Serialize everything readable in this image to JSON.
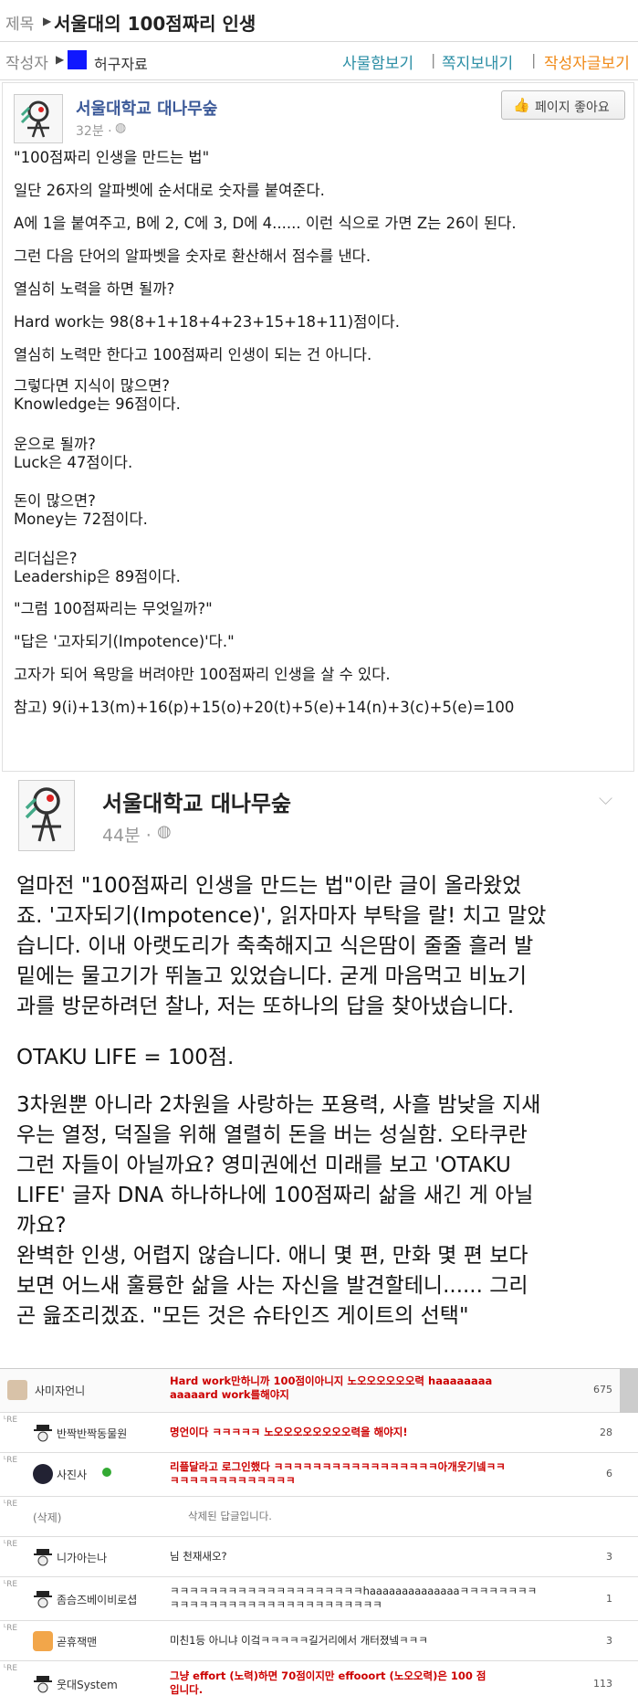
{
  "header": {
    "title_label": "제목",
    "title": "서울대의 100점짜리 인생",
    "author_label": "작성자",
    "author_name": "허구자료",
    "links": [
      "사물함보기",
      "쪽지보내기",
      "작성자글보기"
    ]
  },
  "post1": {
    "page_name": "서울대학교 대나무숲",
    "time": "32분 ·",
    "like_button": "페이지 좋아요",
    "lines": [
      "\"100점짜리 인생을 만드는 법\"",
      "일단 26자의 알파벳에 순서대로 숫자를 붙여준다.",
      "A에 1을 붙여주고, B에 2, C에 3, D에 4...... 이런 식으로 가면 Z는 26이 된다.",
      "그런 다음 단어의 알파벳을 숫자로 환산해서 점수를 낸다.",
      "열심히 노력을 하면 될까?",
      "Hard work는 98(8+1+18+4+23+15+18+11)점이다.",
      "열심히 노력만 한다고 100점짜리 인생이 되는 건 아니다.",
      "그렇다면 지식이 많으면?",
      "Knowledge는 96점이다.",
      "운으로 될까?",
      "Luck은 47점이다.",
      "돈이 많으면?",
      "Money는 72점이다.",
      "리더십은?",
      "Leadership은 89점이다.",
      "\"그럼 100점짜리는 무엇일까?\"",
      "\"답은 '고자되기(Impotence)'다.\"",
      "고자가 되어 욕망을 버려야만 100점짜리 인생을 살 수 있다.",
      "참고) 9(i)+13(m)+16(p)+15(o)+20(t)+5(e)+14(n)+3(c)+5(e)=100"
    ]
  },
  "post2": {
    "page_name": "서울대학교 대나무숲",
    "time": "44분 ·",
    "lines": [
      "얼마전 \"100점짜리 인생을 만드는 법\"이란 글이 올라왔었",
      "죠. '고자되기(Impotence)', 읽자마자 부탁을 랄! 치고 말았",
      "습니다. 이내 아랫도리가 축축해지고 식은땀이 줄줄 흘러 발",
      "밑에는 물고기가 뛰놀고 있었습니다. 굳게 마음먹고 비뇨기",
      "과를 방문하려던 찰나, 저는 또하나의 답을 찾아냈습니다.",
      "OTAKU LIFE = 100점.",
      "3차원뿐 아니라 2차원을 사랑하는 포용력, 사흘 밤낮을 지새",
      "우는 열정, 덕질을 위해 열렬히 돈을 버는 성실함. 오타쿠란",
      "그런 자들이 아닐까요? 영미권에선 미래를 보고 'OTAKU",
      "LIFE' 글자 DNA 하나하나에 100점짜리 삶을 새긴 게 아닐",
      "까요?",
      "완벽한 인생, 어렵지 않습니다. 애니 몇 편, 만화 몇 편 보다",
      "보면 어느새 훌륭한 삶을 사는 자신을 발견할테니...... 그리",
      "곤 읊조리겠죠. \"모든 것은 슈타인즈 게이트의 선택\""
    ]
  },
  "comments": [
    {
      "re": "",
      "name": "사미자언니",
      "text": [
        "Hard work만하니까 100점이아니지 노오오오오오오력 haaaaaaaa",
        "aaaaard work를해야지"
      ],
      "style": "red",
      "count": "675",
      "icon": "woman-avatar-icon"
    },
    {
      "re": "ᴸRE",
      "name": "반짝반짝동물원",
      "text": [
        "명언이다 ㅋㅋㅋㅋㅋ 노오오오오오오오오력을 해야지!"
      ],
      "style": "red",
      "count": "28",
      "icon": "hat-avatar-icon"
    },
    {
      "re": "ᴸRE",
      "name": "사진사",
      "text": [
        "리플달라고 로그인했다 ㅋㅋㅋㅋㅋㅋㅋㅋㅋㅋㅋㅋㅋㅋㅋㅋㅋ아개웃기넼ㅋㅋ",
        "ㅋㅋㅋㅋㅋㅋㅋㅋㅋㅋㅋㅋㅋ"
      ],
      "style": "red",
      "count": "6",
      "icon": "camera-avatar-icon"
    },
    {
      "re": "ᴸRE",
      "name": "(삭제)",
      "text": [
        "삭제된 답글입니다."
      ],
      "style": "gray",
      "count": "",
      "icon": ""
    },
    {
      "re": "ᴸRE",
      "name": "니가아는나",
      "text": [
        "님 천재새오?"
      ],
      "style": "plain",
      "count": "3",
      "icon": "hat-avatar-icon"
    },
    {
      "re": "ᴸRE",
      "name": "좀슴즈베이비로셥",
      "text": [
        "ㅋㅋㅋㅋㅋㅋㅋㅋㅋㅋㅋㅋㅋㅋㅋㅋㅋㅋㅋㅋhaaaaaaaaaaaaaaㅋㅋㅋㅋㅋㅋㅋㅋ",
        "ㅋㅋㅋㅋㅋㅋㅋㅋㅋㅋㅋㅋㅋㅋㅋㅋㅋㅋㅋㅋㅋㅋ"
      ],
      "style": "plain",
      "count": "1",
      "icon": "hat-avatar-icon"
    },
    {
      "re": "ᴸRE",
      "name": "곧휴잭맨",
      "text": [
        "미친1등 아니냐 이겈ㅋㅋㅋㅋㅋ길거리에서 개터졌넼ㅋㅋㅋ"
      ],
      "style": "plain",
      "count": "3",
      "icon": "face-avatar-icon"
    },
    {
      "re": "ᴸRE",
      "name": "웃대System",
      "text": [
        "그냥 effort (노력)하면 70점이지만 effooort (노오오력)은 100 점",
        "입니다."
      ],
      "style": "red",
      "count": "113",
      "icon": "hat-avatar-icon"
    }
  ],
  "colors": {
    "link": "#2b8ea5",
    "orange": "#f08a18",
    "fb_blue": "#3b5998",
    "comment_red": "#cc0000"
  }
}
